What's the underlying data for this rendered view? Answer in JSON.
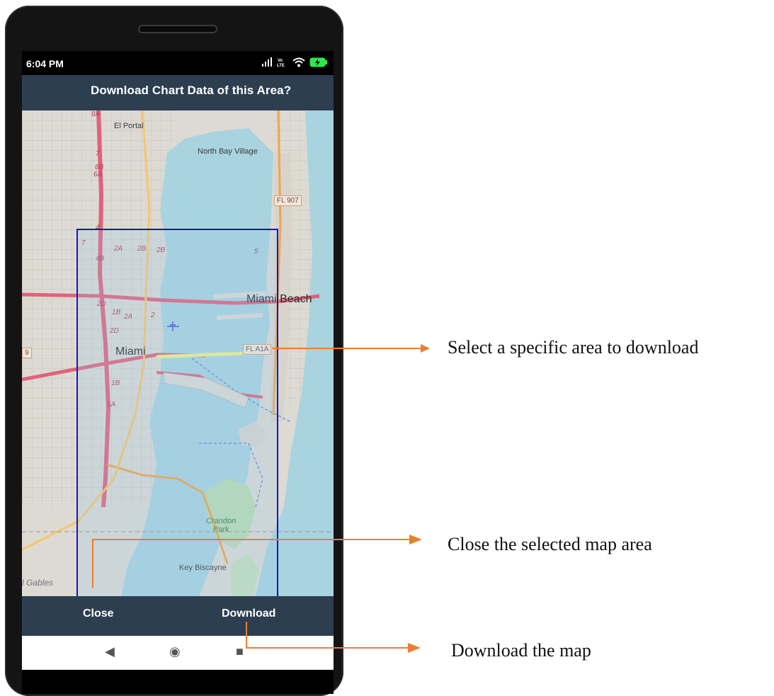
{
  "status": {
    "time": "6:04 PM",
    "icons": [
      "signal-icon",
      "volte-icon",
      "wifi-icon",
      "battery-charging-icon"
    ],
    "volte_text": "Vo\nLTE"
  },
  "dialog": {
    "title": "Download Chart Data of this Area?"
  },
  "map": {
    "labels": {
      "el_portal": "El Portal",
      "north_bay": "North Bay Village",
      "miami_beach": "Miami Beach",
      "miami": "Miami",
      "key_biscayne": "Key Biscayne",
      "crandon_park": "Crandon\nPark",
      "coral_gables": "l Gables"
    },
    "shields": {
      "fl907": "FL 907",
      "fla1a": "FL A1A",
      "nine": "9"
    },
    "exits": [
      "8A",
      "7",
      "6B",
      "6A",
      "4",
      "7",
      "4B",
      "2A",
      "2B",
      "2B",
      "5",
      "2D",
      "1B",
      "2A",
      "2",
      "2D",
      "1B",
      "1A"
    ],
    "colors": {
      "water": "#a9d3df",
      "land": "#dcdad3",
      "highway": "#e0627b",
      "selection": "#1515b8"
    }
  },
  "actions": {
    "close": "Close",
    "download": "Download"
  },
  "nav": {
    "back": "◀",
    "home": "◉",
    "recents": "■"
  },
  "annotations": {
    "select_area": "Select a specific area to download",
    "close_area": "Close the selected map area",
    "download_map": "Download the map"
  },
  "colors": {
    "appbar": "#2c3e50",
    "arrow": "#ed7d31"
  }
}
